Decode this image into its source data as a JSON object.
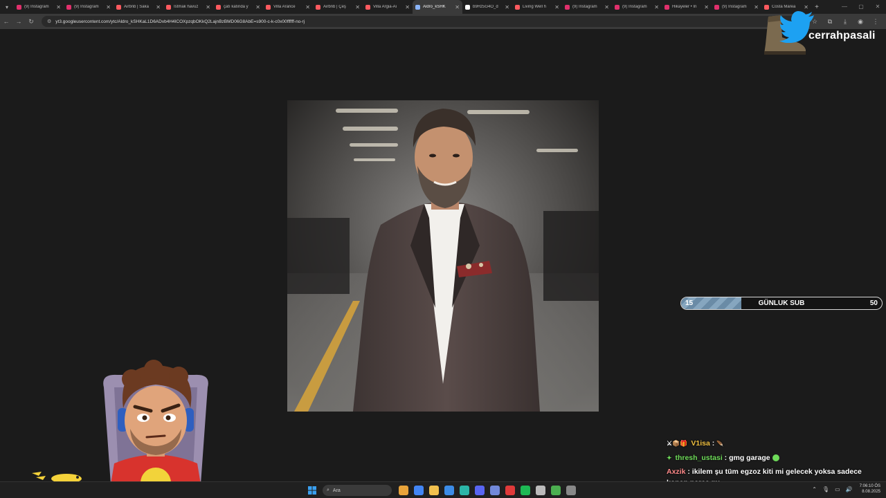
{
  "browser": {
    "tabs": [
      {
        "title": "(9) Instagram",
        "color": "#e1306c"
      },
      {
        "title": "(9) Instagram",
        "color": "#e1306c"
      },
      {
        "title": "Airbnb | Saka",
        "color": "#ff5a5f"
      },
      {
        "title": "İstmak havuz",
        "color": "#ff5a5f"
      },
      {
        "title": "çatı katında y",
        "color": "#ff5a5f"
      },
      {
        "title": "Villa Arance",
        "color": "#ff5a5f"
      },
      {
        "title": "Airbnb | Çeş",
        "color": "#ff5a5f"
      },
      {
        "title": "Villa Argia-Ai",
        "color": "#ff5a5f"
      },
      {
        "title": "Aldro_kSHK",
        "color": "#8ab4f8",
        "active": true
      },
      {
        "title": "b9Hz5G4O_d",
        "color": "#ffffff"
      },
      {
        "title": "Living Well h",
        "color": "#ff5a5f"
      },
      {
        "title": "(9) Instagram",
        "color": "#e1306c"
      },
      {
        "title": "(9) Instagram",
        "color": "#e1306c"
      },
      {
        "title": "Hikayeler • In",
        "color": "#e1306c"
      },
      {
        "title": "(9) Instagram",
        "color": "#e1306c"
      },
      {
        "title": "Costa Marea",
        "color": "#ff5a5f"
      }
    ],
    "url": "yt3.googleusercontent.com/ytc/Aldro_kSHKaL1D6ADvb4H4ICOXpzqbOKkQ2LajnBzBMD06G8AbE=s900-c-k-c0x00ffffff-no-rj"
  },
  "overlay": {
    "brand_name": "cerrahpasali",
    "subgoal": {
      "current": "15",
      "label": "GÜNLUK SUB",
      "goal": "50",
      "progress": 0.3
    },
    "chat": [
      {
        "user": "V1isa",
        "sep": " :",
        "text": "",
        "badges": "⚔📦🎁"
      },
      {
        "user": "thresh_ustasi",
        "sep": " :",
        "text": "gmg garage",
        "badges": "✦"
      },
      {
        "user": "Axzik",
        "sep": " :",
        "text": "ikilem şu tüm egzoz kiti mi gelecek yoksa sadece kopan parça mı",
        "badges": ""
      }
    ]
  },
  "taskbar": {
    "search_placeholder": "Ara",
    "time": "7:06:10 ÖS",
    "date": "8.08.2025",
    "icons": [
      "#e8a33a",
      "#4285f4",
      "#f2c14e",
      "#3c8ce7",
      "#2bb5a8",
      "#5865f2",
      "#7289da",
      "#e03a3a",
      "#1db954",
      "#bbbbbb",
      "#4caf50",
      "#888888"
    ]
  }
}
